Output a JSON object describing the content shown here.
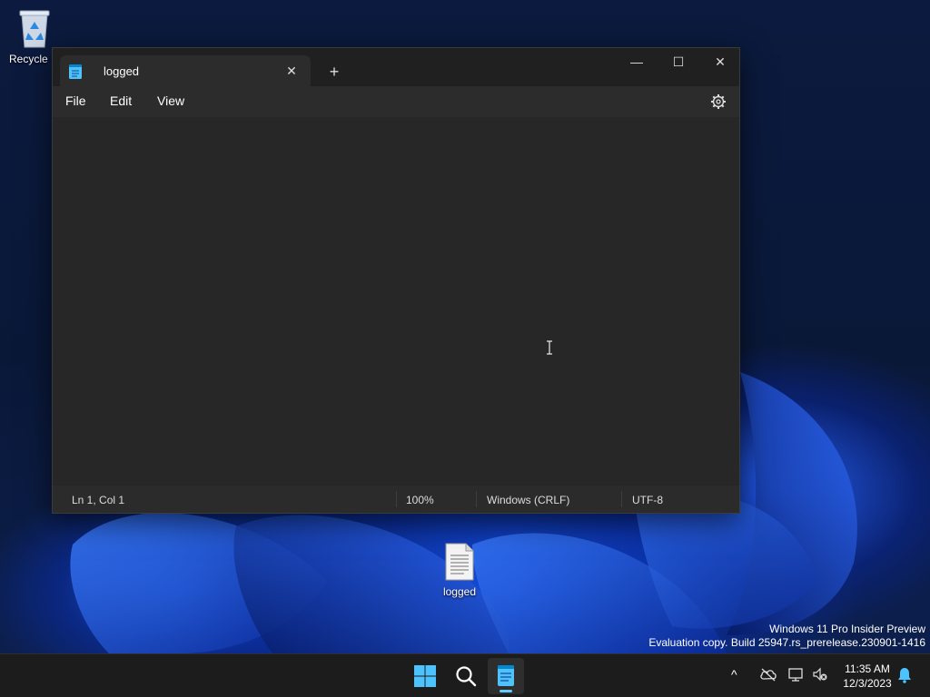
{
  "desktop": {
    "icons": [
      {
        "label": "Recycle Bin",
        "icon": "recycle-bin-icon"
      },
      {
        "label": "logged",
        "icon": "text-file-icon"
      }
    ],
    "watermark": {
      "line1": "Windows 11 Pro Insider Preview",
      "line2": "Evaluation copy. Build 25947.rs_prerelease.230901-1416"
    }
  },
  "notepad": {
    "tab_title": "logged",
    "tab_close": "✕",
    "new_tab": "+",
    "window_controls": {
      "minimize": "—",
      "maximize": "☐",
      "close": "✕"
    },
    "menu": {
      "file": "File",
      "edit": "Edit",
      "view": "View"
    },
    "content": "",
    "status": {
      "position": "Ln 1, Col 1",
      "zoom": "100%",
      "line_ending": "Windows (CRLF)",
      "encoding": "UTF-8"
    }
  },
  "taskbar": {
    "tray_chevron": "^",
    "time": "11:35 AM",
    "date": "12/3/2023"
  },
  "colors": {
    "accent": "#60cdff",
    "window_bg": "#272727",
    "taskbar_bg": "#1c1c1c"
  }
}
